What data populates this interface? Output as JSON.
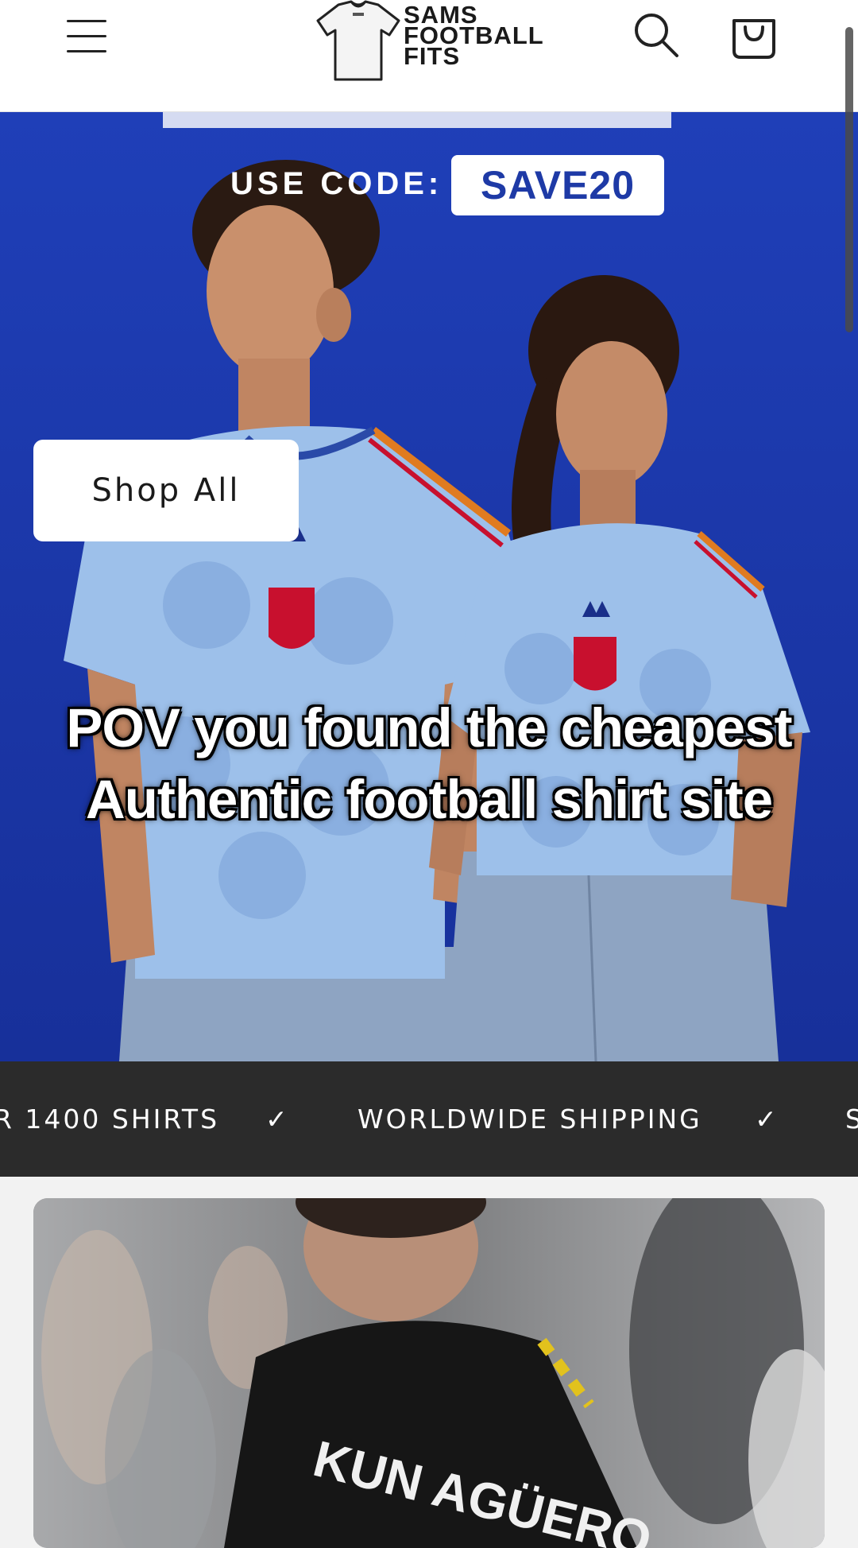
{
  "header": {
    "menu_icon": "hamburger-menu-icon",
    "logo_lines": [
      "SAMS",
      "FOOTBALL",
      "FITS"
    ],
    "search_icon": "search-icon",
    "cart_icon": "shopping-bag-icon"
  },
  "hero": {
    "promo_label": "USE CODE:",
    "promo_code": "SAVE20",
    "shop_button": "Shop All",
    "caption_line1": "POV you found the cheapest",
    "caption_line2": "Authentic football shirt site",
    "background_color": "#1f3fb8"
  },
  "marquee": {
    "items": [
      "R 1400 SHIRTS",
      "✓",
      "WORLDWIDE SHIPPING",
      "✓",
      "S"
    ]
  },
  "card": {
    "shirt_text": "KUN AGÜERO"
  },
  "colors": {
    "header_bg": "#ffffff",
    "marquee_bg": "#2b2b2b",
    "accent_blue": "#1e3aa6"
  }
}
